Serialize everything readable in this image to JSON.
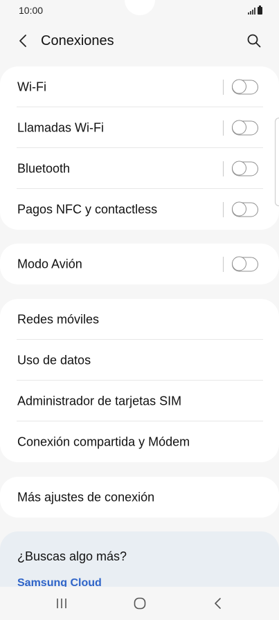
{
  "status": {
    "time": "10:00"
  },
  "header": {
    "title": "Conexiones",
    "back_icon": "chevron-left-icon",
    "search_icon": "search-icon"
  },
  "groups": [
    {
      "items": [
        {
          "label": "Wi-Fi",
          "toggle": false
        },
        {
          "label": "Llamadas Wi-Fi",
          "toggle": false
        },
        {
          "label": "Bluetooth",
          "toggle": false
        },
        {
          "label": "Pagos NFC y contactless",
          "toggle": false
        }
      ]
    },
    {
      "items": [
        {
          "label": "Modo Avión",
          "toggle": false
        }
      ]
    },
    {
      "items": [
        {
          "label": "Redes móviles"
        },
        {
          "label": "Uso de datos"
        },
        {
          "label": "Administrador de tarjetas SIM"
        },
        {
          "label": "Conexión compartida y Módem"
        }
      ]
    },
    {
      "items": [
        {
          "label": "Más ajustes de conexión"
        }
      ]
    }
  ],
  "suggestions": {
    "title": "¿Buscas algo más?",
    "link": "Samsung Cloud"
  },
  "colors": {
    "background": "#f6f6f6",
    "card": "#ffffff",
    "suggest_card": "#e9eef3",
    "link": "#2f64c8"
  }
}
